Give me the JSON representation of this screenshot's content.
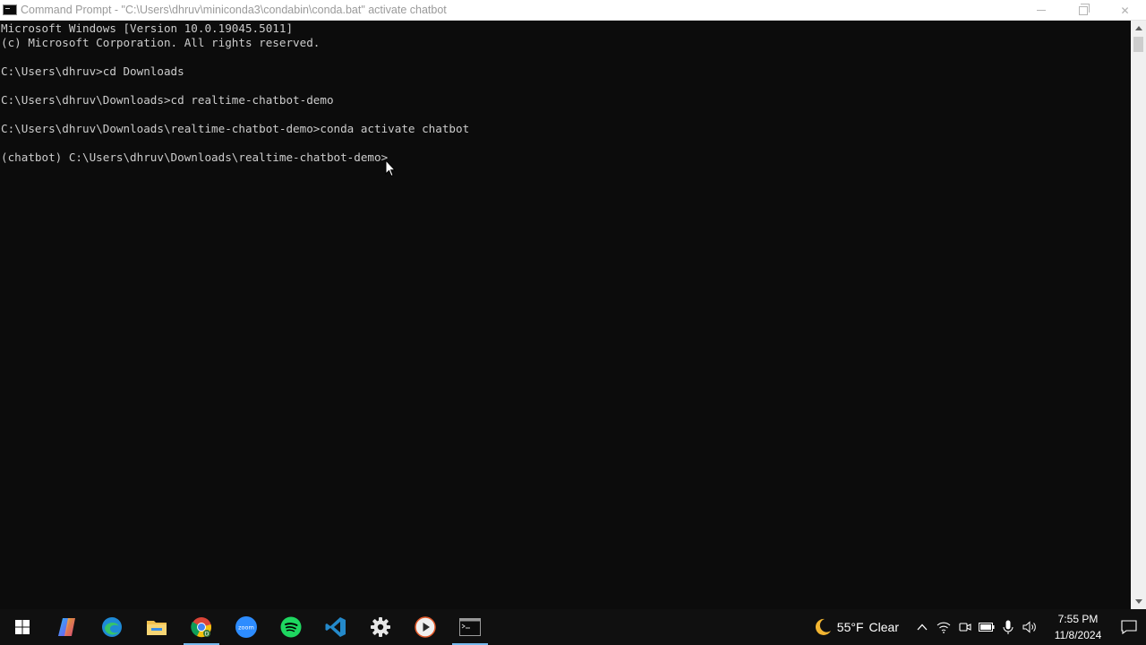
{
  "window": {
    "title": "Command Prompt - \"C:\\Users\\dhruv\\miniconda3\\condabin\\conda.bat\"  activate chatbot",
    "minimize_label": "minimize",
    "maximize_label": "maximize",
    "close_label": "✕"
  },
  "console": {
    "lines": [
      "Microsoft Windows [Version 10.0.19045.5011]",
      "(c) Microsoft Corporation. All rights reserved.",
      "",
      "C:\\Users\\dhruv>cd Downloads",
      "",
      "C:\\Users\\dhruv\\Downloads>cd realtime-chatbot-demo",
      "",
      "C:\\Users\\dhruv\\Downloads\\realtime-chatbot-demo>conda activate chatbot",
      "",
      "(chatbot) C:\\Users\\dhruv\\Downloads\\realtime-chatbot-demo>"
    ]
  },
  "taskbar": {
    "apps": [
      {
        "name": "start-button",
        "icon": "windows-logo-icon"
      },
      {
        "name": "copilot",
        "icon": "copilot-icon"
      },
      {
        "name": "edge",
        "icon": "edge-icon"
      },
      {
        "name": "file-explorer",
        "icon": "folder-icon"
      },
      {
        "name": "chrome",
        "icon": "chrome-icon"
      },
      {
        "name": "zoom",
        "icon": "zoom-icon",
        "label": "zoom"
      },
      {
        "name": "spotify",
        "icon": "spotify-icon"
      },
      {
        "name": "vscode",
        "icon": "vscode-icon"
      },
      {
        "name": "settings",
        "icon": "gear-icon"
      },
      {
        "name": "media-player",
        "icon": "play-icon"
      },
      {
        "name": "command-prompt",
        "icon": "terminal-icon"
      }
    ],
    "weather": {
      "temp": "55°F",
      "condition": "Clear",
      "icon": "moon-icon"
    },
    "clock": {
      "time": "7:55 PM",
      "date": "11/8/2024"
    }
  },
  "colors": {
    "console_bg": "#0c0c0c",
    "console_fg": "#cccccc",
    "taskbar_bg": "#101010",
    "accent": "#76b9ed"
  }
}
